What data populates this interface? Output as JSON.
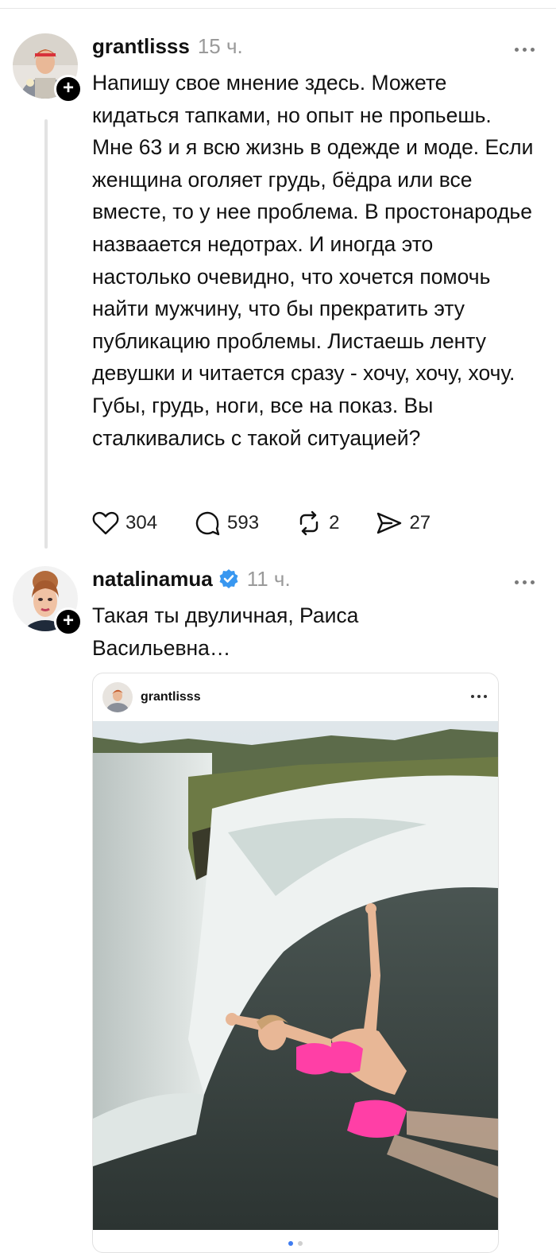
{
  "posts": [
    {
      "username": "grantlisss",
      "time": "15 ч.",
      "text": "Напишу свое мнение здесь. Можете кидаться тапками, но опыт не пропьешь. Мне 63 и я всю жизнь в одежде и моде. Если женщина оголяет грудь, бёдра или все вместе, то у нее проблема. В простонародье назваается недотрах. И иногда это настолько очевидно, что хочется помочь найти мужчину, что бы прекратить эту публикацию проблемы. Листаешь ленту девушки и читается сразу - хочу, хочу, хочу. Губы, грудь, ноги, все на показ. Вы сталкивались с такой ситуацией?",
      "actions": {
        "likes": "304",
        "comments": "593",
        "reposts": "2",
        "shares": "27"
      }
    },
    {
      "username": "natalinamua",
      "time": "11 ч.",
      "text": "Такая ты двуличная, Раиса Васильевна…",
      "embed": {
        "username": "grantlisss"
      }
    }
  ],
  "colors": {
    "verified": "#3897f0",
    "bikini": "#ff3fa6",
    "accent": "#3f7cf0"
  },
  "icons": [
    "more-icon",
    "plus-icon",
    "heart-icon",
    "comment-icon",
    "repost-icon",
    "share-icon",
    "verified-icon"
  ]
}
